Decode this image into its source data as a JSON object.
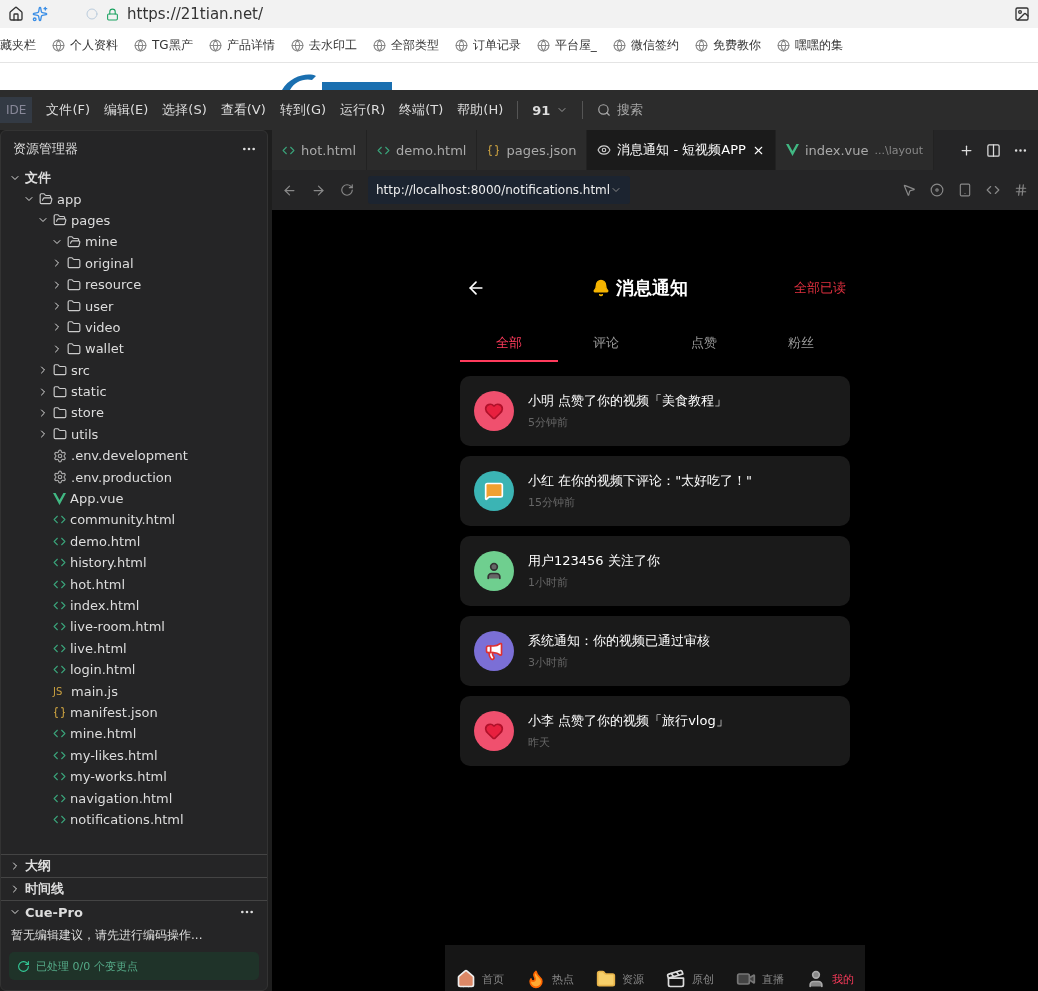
{
  "browser": {
    "url": "https://21tian.net/",
    "bookmarks": [
      "藏夹栏",
      "个人资料",
      "TG黑产",
      "产品详情",
      "去水印工",
      "全部类型",
      "订单记录",
      "平台屋_",
      "微信签约",
      "免费教你",
      "嘿嘿的集"
    ]
  },
  "ide": {
    "logo": "IDE",
    "menu": [
      "文件(F)",
      "编辑(E)",
      "选择(S)",
      "查看(V)",
      "转到(G)",
      "运行(R)",
      "终端(T)",
      "帮助(H)"
    ],
    "counter": "91",
    "search_placeholder": "搜索"
  },
  "explorer": {
    "title": "资源管理器",
    "tree": [
      {
        "label": "文件",
        "kind": "section",
        "expanded": true,
        "children": [
          {
            "label": "app",
            "kind": "folder",
            "expanded": true,
            "children": [
              {
                "label": "pages",
                "kind": "folder",
                "expanded": true,
                "children": [
                  {
                    "label": "mine",
                    "kind": "folder",
                    "expanded": true
                  },
                  {
                    "label": "original",
                    "kind": "folder",
                    "expanded": false
                  },
                  {
                    "label": "resource",
                    "kind": "folder",
                    "expanded": false
                  },
                  {
                    "label": "user",
                    "kind": "folder",
                    "expanded": false
                  },
                  {
                    "label": "video",
                    "kind": "folder",
                    "expanded": false
                  },
                  {
                    "label": "wallet",
                    "kind": "folder",
                    "expanded": false
                  }
                ]
              },
              {
                "label": "src",
                "kind": "folder",
                "expanded": false
              },
              {
                "label": "static",
                "kind": "folder",
                "expanded": false
              },
              {
                "label": "store",
                "kind": "folder",
                "expanded": false
              },
              {
                "label": "utils",
                "kind": "folder",
                "expanded": false
              },
              {
                "label": ".env.development",
                "kind": "config"
              },
              {
                "label": ".env.production",
                "kind": "config"
              },
              {
                "label": "App.vue",
                "kind": "vue"
              },
              {
                "label": "community.html",
                "kind": "html"
              },
              {
                "label": "demo.html",
                "kind": "html"
              },
              {
                "label": "history.html",
                "kind": "html"
              },
              {
                "label": "hot.html",
                "kind": "html"
              },
              {
                "label": "index.html",
                "kind": "html"
              },
              {
                "label": "live-room.html",
                "kind": "html"
              },
              {
                "label": "live.html",
                "kind": "html"
              },
              {
                "label": "login.html",
                "kind": "html"
              },
              {
                "label": "main.js",
                "kind": "js",
                "icon_text": "JS"
              },
              {
                "label": "manifest.json",
                "kind": "json"
              },
              {
                "label": "mine.html",
                "kind": "html"
              },
              {
                "label": "my-likes.html",
                "kind": "html"
              },
              {
                "label": "my-works.html",
                "kind": "html"
              },
              {
                "label": "navigation.html",
                "kind": "html"
              },
              {
                "label": "notifications.html",
                "kind": "html"
              }
            ]
          }
        ]
      }
    ],
    "panels": [
      {
        "label": "大纲",
        "expanded": false
      },
      {
        "label": "时间线",
        "expanded": false
      },
      {
        "label": "Cue-Pro",
        "expanded": true
      }
    ],
    "cue_message": "暂无编辑建议，请先进行编码操作...",
    "cue_status": "已处理 0/0 个变更点"
  },
  "editor_tabs": [
    {
      "label": "hot.html",
      "kind": "html",
      "selected": false
    },
    {
      "label": "demo.html",
      "kind": "html",
      "selected": false
    },
    {
      "label": "pages.json",
      "kind": "json",
      "selected": false
    },
    {
      "label": "消息通知 - 短视频APP",
      "kind": "preview",
      "selected": true
    },
    {
      "label": "index.vue",
      "kind": "vue",
      "selected": false,
      "detail": "...\\layout"
    }
  ],
  "preview_url": "http://localhost:8000/notifications.html",
  "app": {
    "title": "消息通知",
    "mark_all": "全部已读",
    "tabs": [
      {
        "label": "全部",
        "selected": true
      },
      {
        "label": "评论",
        "selected": false
      },
      {
        "label": "点赞",
        "selected": false
      },
      {
        "label": "粉丝",
        "selected": false
      }
    ],
    "notifications": [
      {
        "kind": "like",
        "text": "小明 点赞了你的视频「美食教程」",
        "time": "5分钟前"
      },
      {
        "kind": "comment",
        "text": "小红 在你的视频下评论：\"太好吃了！\"",
        "time": "15分钟前"
      },
      {
        "kind": "follow",
        "text": "用户123456 关注了你",
        "time": "1小时前"
      },
      {
        "kind": "system",
        "text": "系统通知：你的视频已通过审核",
        "time": "3小时前"
      },
      {
        "kind": "like",
        "text": "小李 点赞了你的视频「旅行vlog」",
        "time": "昨天"
      }
    ],
    "nav": [
      {
        "label": "首页",
        "kind": "home",
        "selected": false
      },
      {
        "label": "热点",
        "kind": "hot",
        "selected": false
      },
      {
        "label": "资源",
        "kind": "folder",
        "selected": false
      },
      {
        "label": "原创",
        "kind": "clapper",
        "selected": false
      },
      {
        "label": "直播",
        "kind": "camera",
        "selected": false
      },
      {
        "label": "我的",
        "kind": "user",
        "selected": true
      }
    ]
  }
}
